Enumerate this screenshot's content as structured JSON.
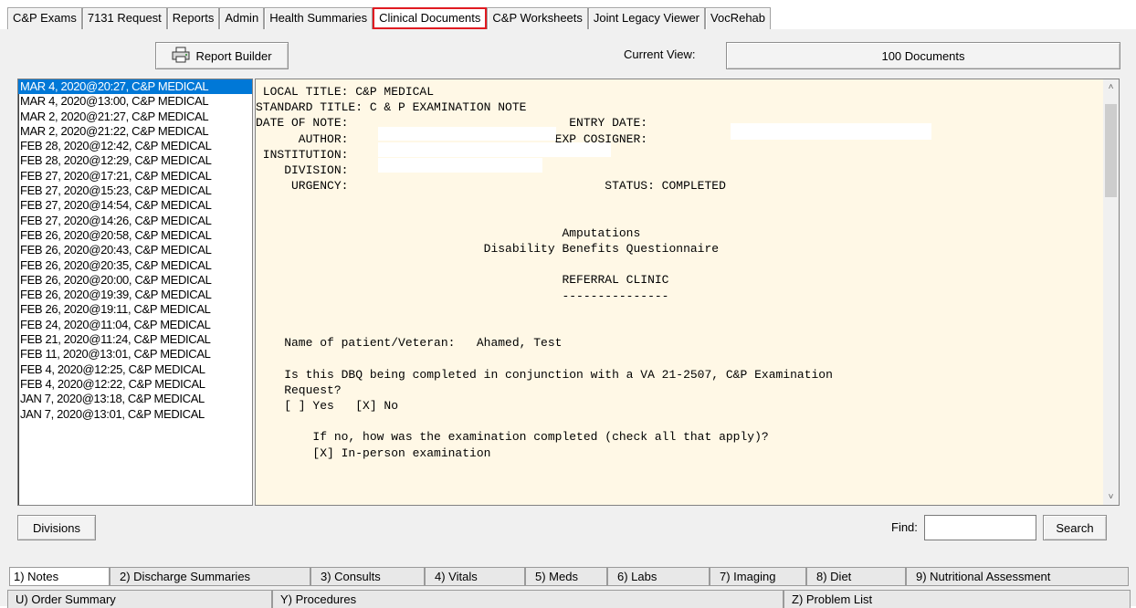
{
  "top_tabs": [
    {
      "label": "C&P Exams",
      "active": false
    },
    {
      "label": "7131 Request",
      "active": false
    },
    {
      "label": "Reports",
      "active": false
    },
    {
      "label": "Admin",
      "active": false
    },
    {
      "label": "Health Summaries",
      "active": false
    },
    {
      "label": "Clinical Documents",
      "active": true
    },
    {
      "label": "C&P Worksheets",
      "active": false
    },
    {
      "label": "Joint Legacy Viewer",
      "active": false
    },
    {
      "label": "VocRehab",
      "active": false
    }
  ],
  "toolbar": {
    "report_builder_label": "Report Builder",
    "current_view_label": "Current View:",
    "current_view_value": "100 Documents"
  },
  "documents": [
    "MAR 4, 2020@20:27, C&P MEDICAL",
    "MAR 4, 2020@13:00, C&P MEDICAL",
    "MAR 2, 2020@21:27, C&P MEDICAL",
    "MAR 2, 2020@21:22, C&P MEDICAL",
    "FEB 28, 2020@12:42, C&P MEDICAL",
    "FEB 28, 2020@12:29, C&P MEDICAL",
    "FEB 27, 2020@17:21, C&P MEDICAL",
    "FEB 27, 2020@15:23, C&P MEDICAL",
    "FEB 27, 2020@14:54, C&P MEDICAL",
    "FEB 27, 2020@14:26, C&P MEDICAL",
    "FEB 26, 2020@20:58, C&P MEDICAL",
    "FEB 26, 2020@20:43, C&P MEDICAL",
    "FEB 26, 2020@20:35, C&P MEDICAL",
    "FEB 26, 2020@20:00, C&P MEDICAL",
    "FEB 26, 2020@19:39, C&P MEDICAL",
    "FEB 26, 2020@19:11, C&P MEDICAL",
    "FEB 24, 2020@11:04, C&P MEDICAL",
    "FEB 21, 2020@11:24, C&P MEDICAL",
    "FEB 11, 2020@13:01, C&P MEDICAL",
    "FEB 4, 2020@12:25, C&P MEDICAL",
    "FEB 4, 2020@12:22, C&P MEDICAL",
    "JAN 7, 2020@13:18, C&P MEDICAL",
    "JAN 7, 2020@13:01, C&P MEDICAL"
  ],
  "note": {
    "lines": [
      " LOCAL TITLE: C&P MEDICAL",
      "STANDARD TITLE: C & P EXAMINATION NOTE",
      "DATE OF NOTE:                               ENTRY DATE:",
      "      AUTHOR:                             EXP COSIGNER:",
      " INSTITUTION:",
      "    DIVISION:",
      "     URGENCY:                                    STATUS: COMPLETED",
      "",
      "",
      "                                           Amputations",
      "                                Disability Benefits Questionnaire",
      "",
      "                                           REFERRAL CLINIC",
      "                                           ---------------",
      "",
      "",
      "    Name of patient/Veteran:   Ahamed, Test",
      "",
      "    Is this DBQ being completed in conjunction with a VA 21-2507, C&P Examination",
      "    Request?",
      "    [ ] Yes   [X] No",
      "",
      "        If no, how was the examination completed (check all that apply)?",
      "        [X] In-person examination"
    ]
  },
  "bottom": {
    "divisions_label": "Divisions",
    "find_label": "Find:",
    "find_value": "",
    "search_label": "Search"
  },
  "bottom_tabs_row1": [
    {
      "label": "1) Notes",
      "active": true
    },
    {
      "label": "2) Discharge Summaries",
      "active": false
    },
    {
      "label": "3) Consults",
      "active": false
    },
    {
      "label": "4) Vitals",
      "active": false
    },
    {
      "label": "5) Meds",
      "active": false
    },
    {
      "label": "6) Labs",
      "active": false
    },
    {
      "label": "7) Imaging",
      "active": false
    },
    {
      "label": "8) Diet",
      "active": false
    },
    {
      "label": "9) Nutritional Assessment",
      "active": false
    }
  ],
  "bottom_tabs_row2": [
    {
      "label": "U) Order Summary"
    },
    {
      "label": "Y) Procedures"
    },
    {
      "label": "Z) Problem List"
    }
  ],
  "icons": {
    "report_builder": "printer-icon",
    "scroll_up": "chevron-up-icon",
    "scroll_down": "chevron-down-icon"
  }
}
